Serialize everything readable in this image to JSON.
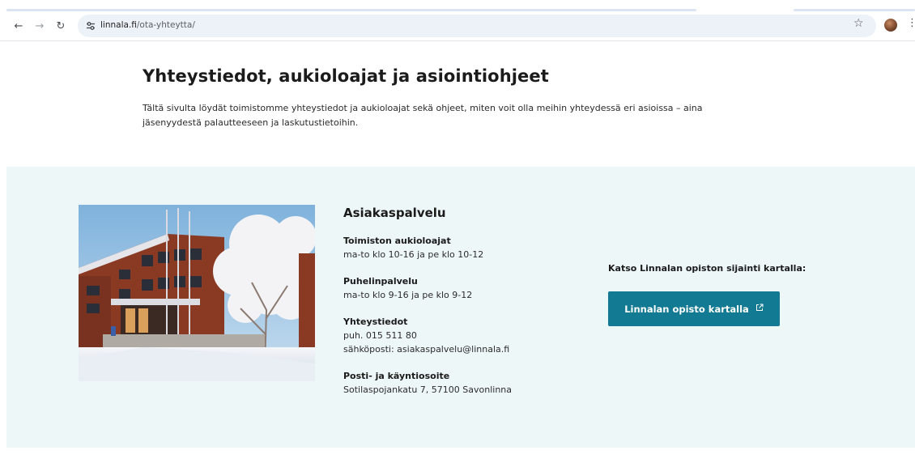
{
  "browser": {
    "back_icon": "arrow-left-icon",
    "forward_icon": "arrow-right-icon",
    "reload_icon": "reload-icon",
    "site_info_icon": "tune-icon",
    "url_host": "linnala.fi",
    "url_path": "/ota-yhteytta/",
    "bookmark_icon": "star-icon",
    "menu_icon": "kebab-menu-icon"
  },
  "page": {
    "title": "Yhteystiedot, aukioloajat ja asiointiohjeet",
    "intro": "Tältä sivulta löydät toimistomme yhteystiedot ja aukioloajat sekä ohjeet, miten voit olla meihin yhteydessä eri asioissa – aina jäsenyydestä palautteeseen ja laskutustietoihin."
  },
  "contact": {
    "heading": "Asiakaspalvelu",
    "office_hours": {
      "label": "Toimiston aukioloajat",
      "value": "ma-to klo 10-16 ja pe klo 10-12"
    },
    "phone_service": {
      "label": "Puhelinpalvelu",
      "value": "ma-to klo 9-16 ja pe klo 9-12"
    },
    "contact_details": {
      "label": "Yhteystiedot",
      "phone": "puh. 015 511 80",
      "email": "sähköposti: asiakaspalvelu@linnala.fi"
    },
    "address": {
      "label": "Posti- ja käyntiosoite",
      "value": "Sotilaspojankatu 7, 57100 Savonlinna"
    }
  },
  "map": {
    "label": "Katso Linnalan opiston sijainti kartalla:",
    "button_label": "Linnalan opisto kartalla",
    "button_icon": "external-link-icon"
  },
  "colors": {
    "band_background": "#eef7f8",
    "button_background": "#137a93",
    "button_text": "#ffffff"
  }
}
